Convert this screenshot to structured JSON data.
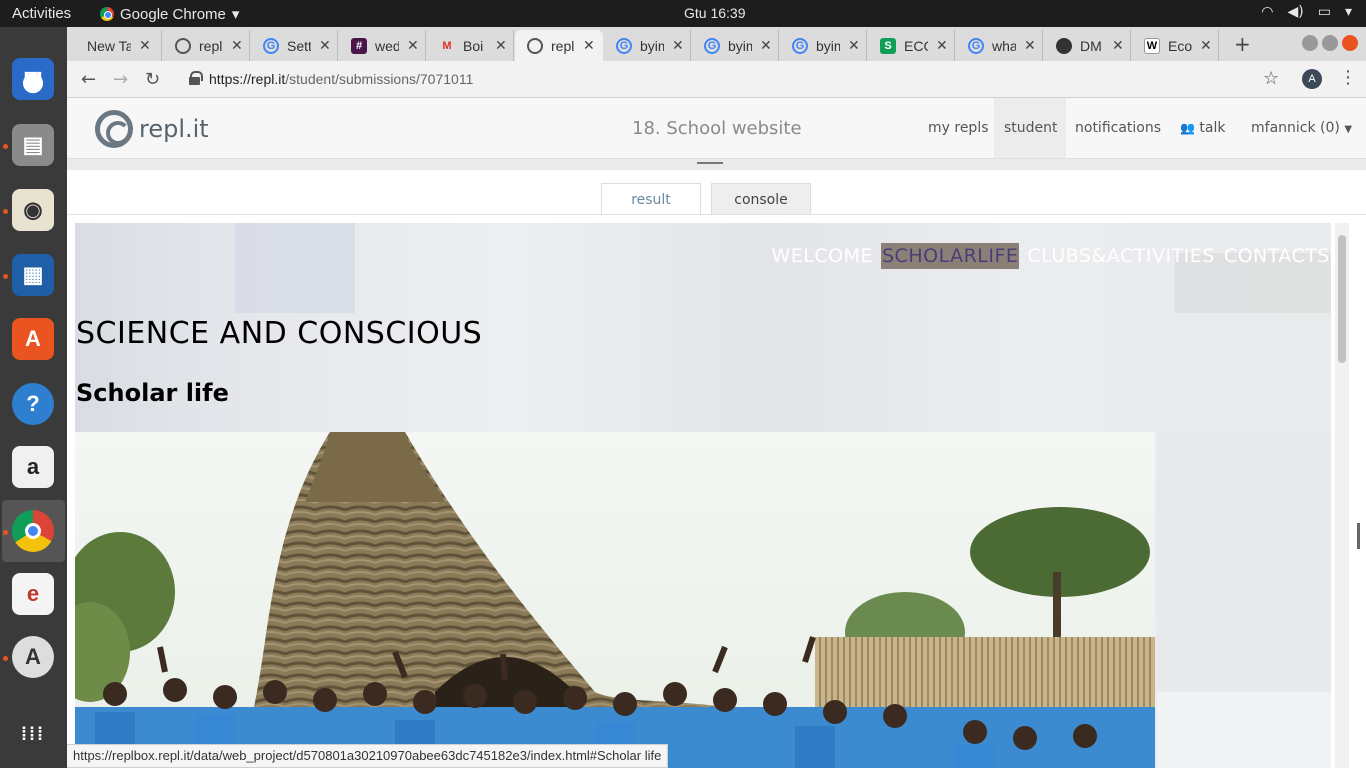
{
  "topbar": {
    "activities": "Activities",
    "app_name": "Google Chrome",
    "clock": "Gtu 16:39",
    "icons": [
      "wifi-icon",
      "volume-icon",
      "battery-icon",
      "chevron-down-icon"
    ]
  },
  "dock": {
    "items": [
      "thunderbird-icon",
      "files-icon",
      "rhythmbox-icon",
      "writer-icon",
      "software-center-icon",
      "help-icon",
      "amazon-icon",
      "chrome-icon",
      "evince-icon",
      "updater-icon",
      "apps-grid-icon"
    ]
  },
  "browser": {
    "tabs": [
      {
        "title": "New Tab",
        "favicon": "newtab"
      },
      {
        "title": "repl.it",
        "favicon": "repl"
      },
      {
        "title": "Settings",
        "favicon": "google"
      },
      {
        "title": "wed",
        "favicon": "slack"
      },
      {
        "title": "Boi",
        "favicon": "gmail"
      },
      {
        "title": "repl.it",
        "favicon": "repl"
      },
      {
        "title": "byimana",
        "favicon": "google"
      },
      {
        "title": "byimana",
        "favicon": "google"
      },
      {
        "title": "byimana",
        "favicon": "google"
      },
      {
        "title": "ECO",
        "favicon": "sheets"
      },
      {
        "title": "what",
        "favicon": "google"
      },
      {
        "title": "DM",
        "favicon": "dm"
      },
      {
        "title": "Eco",
        "favicon": "wikipedia"
      }
    ],
    "url_host": "https://repl.it",
    "url_path": "/student/submissions/7071011",
    "profile_letter": "A",
    "status_url": "https://replbox.repl.it/data/web_project/d570801a30210970abee63dc745182e3/index.html#Scholar life"
  },
  "repl": {
    "logo_text": "repl.it",
    "project_title": "18. School website",
    "nav": {
      "my_repls": "my repls",
      "student": "student",
      "notifications": "notifications",
      "talk": "talk",
      "user": "mfannick (0)"
    },
    "tabs": {
      "result": "result",
      "console": "console"
    }
  },
  "site": {
    "nav": [
      "WELCOME",
      "SCHOLARLIFE",
      "CLUBS&ACTIVITIES",
      "CONTACTS"
    ],
    "nav_current": "SCHOLARLIFE",
    "heading": "SCIENCE AND CONSCIOUS",
    "subheading": "Scholar life",
    "photo_alt": "students-in-front-of-traditional-hut"
  },
  "colors": {
    "nav_highlight_bg": "#8a8078",
    "nav_highlight_text": "#4b3d78",
    "ubuntu_orange": "#e95420"
  }
}
